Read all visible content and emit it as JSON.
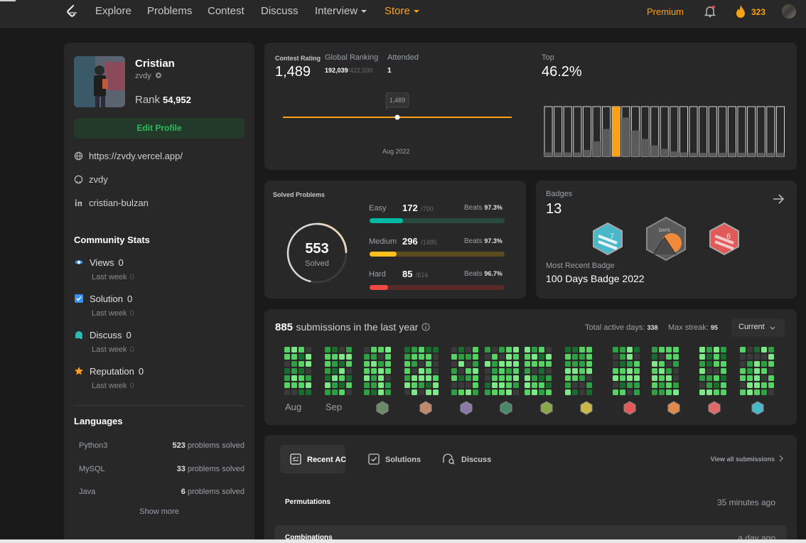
{
  "nav": {
    "items": [
      "Explore",
      "Problems",
      "Contest",
      "Discuss",
      "Interview",
      "Store"
    ],
    "premium": "Premium",
    "streak": "323"
  },
  "profile": {
    "name": "Cristian",
    "handle": "zvdy",
    "rank_label": "Rank",
    "rank": "54,952",
    "edit": "Edit Profile",
    "links": [
      "https://zvdy.vercel.app/",
      "zvdy",
      "cristian-bulzan"
    ]
  },
  "community": {
    "title": "Community Stats",
    "stats": [
      {
        "label": "Views",
        "value": "0",
        "lastweek": "0"
      },
      {
        "label": "Solution",
        "value": "0",
        "lastweek": "0"
      },
      {
        "label": "Discuss",
        "value": "0",
        "lastweek": "0"
      },
      {
        "label": "Reputation",
        "value": "0",
        "lastweek": "0"
      }
    ],
    "lastweek_label": "Last week"
  },
  "languages": {
    "title": "Languages",
    "items": [
      {
        "name": "Python3",
        "count": "523",
        "suffix": "problems solved"
      },
      {
        "name": "MySQL",
        "count": "33",
        "suffix": "problems solved"
      },
      {
        "name": "Java",
        "count": "6",
        "suffix": "problems solved"
      }
    ],
    "show_more": "Show more"
  },
  "contest": {
    "rating_label": "Contest Rating",
    "rating": "1,489",
    "global_label": "Global Ranking",
    "global": "192,039",
    "global_total": "/422,590",
    "attended_label": "Attended",
    "attended": "1",
    "tooltip": "1,489",
    "date": "Aug 2022",
    "top_label": "Top",
    "top": "46.2%",
    "histogram": [
      0.08,
      0.08,
      0.08,
      0.08,
      0.13,
      0.3,
      0.55,
      1.0,
      0.78,
      0.52,
      0.35,
      0.22,
      0.15,
      0.1,
      0.08,
      0.06,
      0.06,
      0.06,
      0.06,
      0.06,
      0.06,
      0.06,
      0.06,
      0.06,
      0.06
    ],
    "highlight_index": 7
  },
  "solved": {
    "title": "Solved Problems",
    "total": "553",
    "solved_label": "Solved",
    "beats_label": "Beats",
    "rows": [
      {
        "label": "Easy",
        "count": "172",
        "total": "/700",
        "beats": "97.3%",
        "frac": 0.246,
        "color": "#00b8a3",
        "track": "#2a4a3f"
      },
      {
        "label": "Medium",
        "count": "296",
        "total": "/1485",
        "beats": "97.3%",
        "frac": 0.199,
        "color": "#ffc01e",
        "track": "#5a4a1f"
      },
      {
        "label": "Hard",
        "count": "85",
        "total": "/616",
        "beats": "96.7%",
        "frac": 0.138,
        "color": "#ef4743",
        "track": "#5a2a28"
      }
    ]
  },
  "badges": {
    "label": "Badges",
    "count": "13",
    "recent_label": "Most Recent Badge",
    "recent": "100 Days Badge 2022"
  },
  "submissions": {
    "count": "885",
    "text": "submissions in the last year",
    "active_label": "Total active days:",
    "active": "338",
    "streak_label": "Max streak:",
    "streak": "95",
    "selector": "Current",
    "months": [
      "Aug",
      "Sep"
    ]
  },
  "recent": {
    "tabs": [
      "Recent AC",
      "Solutions",
      "Discuss"
    ],
    "view_all": "View all submissions",
    "items": [
      {
        "title": "Permutations",
        "time": "35 minutes ago"
      },
      {
        "title": "Combinations",
        "time": "a day ago"
      }
    ]
  },
  "colors": {
    "accent": "#ffa116",
    "green": "#2cbb5d",
    "card": "#282828",
    "bg": "#1a1a1a"
  }
}
